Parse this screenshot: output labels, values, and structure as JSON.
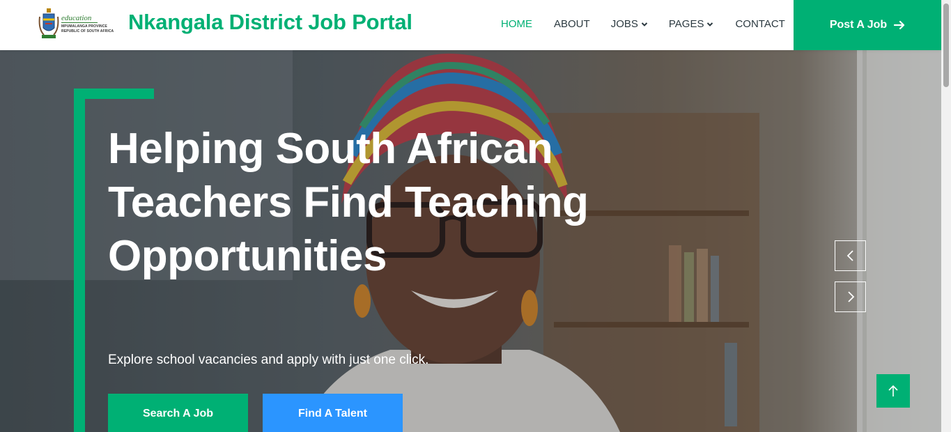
{
  "header": {
    "logo": {
      "icon": "coat-of-arms-icon",
      "word": "education",
      "line1": "MPUMALANGA PROVINCE",
      "line2": "REPUBLIC OF SOUTH AFRICA"
    },
    "brand": "Nkangala District Job Portal",
    "nav": {
      "home": "HOME",
      "about": "ABOUT",
      "jobs": "JOBS",
      "pages": "PAGES",
      "contact": "CONTACT"
    },
    "post_job": "Post A Job",
    "post_job_icon": "arrow-right-icon"
  },
  "hero": {
    "title": "Helping South African Teachers Find Teaching Opportunities",
    "subtitle": "Explore school vacancies and apply with just one click.",
    "search_button": "Search A Job",
    "talent_button": "Find A Talent",
    "carousel": {
      "prev_icon": "chevron-left-icon",
      "next_icon": "chevron-right-icon"
    },
    "back_to_top_icon": "arrow-up-icon"
  },
  "colors": {
    "accent_green": "#00b074",
    "accent_blue": "#2b95ff",
    "text_dark": "#2b3940"
  }
}
